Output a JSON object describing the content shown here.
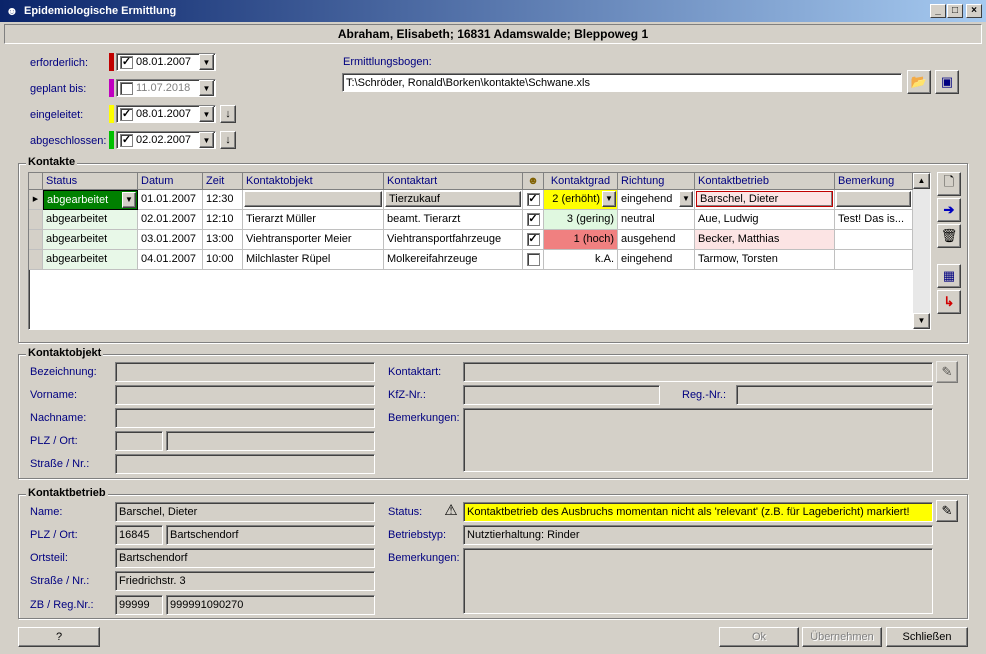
{
  "window": {
    "title": "Epidemiologische Ermittlung",
    "icon": "person-icon"
  },
  "header": {
    "text": "Abraham, Elisabeth; 16831 Adamswalde; Bleppoweg 1"
  },
  "dates": [
    {
      "label": "erforderlich:",
      "value": "08.01.2007",
      "checked": true,
      "color": "#c00000"
    },
    {
      "label": "geplant bis:",
      "value": "11.07.2018",
      "checked": false,
      "color": "#c000c0"
    },
    {
      "label": "eingeleitet:",
      "value": "08.01.2007",
      "checked": true,
      "color": "#ffff00"
    },
    {
      "label": "abgeschlossen:",
      "value": "02.02.2007",
      "checked": true,
      "color": "#00c000"
    }
  ],
  "ermittlungsbogen": {
    "label": "Ermittlungsbogen:",
    "value": "T:\\Schröder, Ronald\\Borken\\kontakte\\Schwane.xls"
  },
  "kontakte": {
    "title": "Kontakte",
    "columns": [
      "Status",
      "Datum",
      "Zeit",
      "Kontaktobjekt",
      "Kontaktart",
      "",
      "Kontaktgrad",
      "Richtung",
      "Kontaktbetrieb",
      "Bemerkung"
    ],
    "rows": [
      {
        "status": "abgearbeitet",
        "datum": "01.01.2007",
        "zeit": "12:30",
        "objekt": "",
        "art": "Tierzukauf",
        "checked": true,
        "grad": "2 (erhöht)",
        "richtung": "eingehend",
        "betrieb": "Barschel, Dieter",
        "bemerkung": ""
      },
      {
        "status": "abgearbeitet",
        "datum": "02.01.2007",
        "zeit": "12:10",
        "objekt": "Tierarzt Müller",
        "art": "beamt. Tierarzt",
        "checked": true,
        "grad": "3 (gering)",
        "richtung": "neutral",
        "betrieb": "Aue, Ludwig",
        "bemerkung": "Test! Das is..."
      },
      {
        "status": "abgearbeitet",
        "datum": "03.01.2007",
        "zeit": "13:00",
        "objekt": "Viehtransporter Meier",
        "art": "Viehtransportfahrzeuge",
        "checked": true,
        "grad": "1 (hoch)",
        "richtung": "ausgehend",
        "betrieb": "Becker, Matthias",
        "bemerkung": ""
      },
      {
        "status": "abgearbeitet",
        "datum": "04.01.2007",
        "zeit": "10:00",
        "objekt": "Milchlaster Rüpel",
        "art": "Molkereifahrzeuge",
        "checked": false,
        "grad": "k.A.",
        "richtung": "eingehend",
        "betrieb": "Tarmow, Torsten",
        "bemerkung": ""
      }
    ]
  },
  "kontaktobjekt": {
    "title": "Kontaktobjekt",
    "labels": {
      "bezeichnung": "Bezeichnung:",
      "vorname": "Vorname:",
      "nachname": "Nachname:",
      "plz": "PLZ / Ort:",
      "strasse": "Straße / Nr.:",
      "kontaktart": "Kontaktart:",
      "kfz": "KfZ-Nr.:",
      "reg": "Reg.-Nr.:",
      "bemerkungen": "Bemerkungen:"
    }
  },
  "kontaktbetrieb": {
    "title": "Kontaktbetrieb",
    "labels": {
      "name": "Name:",
      "plz": "PLZ / Ort:",
      "ortsteil": "Ortsteil:",
      "strasse": "Straße / Nr.:",
      "zb": "ZB / Reg.Nr.:",
      "status": "Status:",
      "betriebstyp": "Betriebstyp:",
      "bemerkungen": "Bemerkungen:"
    },
    "name": "Barschel, Dieter",
    "plz": "16845",
    "ort": "Bartschendorf",
    "ortsteil": "Bartschendorf",
    "strasse": "Friedrichstr. 3",
    "zb": "99999",
    "regnr": "999991090270",
    "status": "Kontaktbetrieb des Ausbruchs momentan nicht als 'relevant' (z.B. für Lagebericht) markiert!",
    "betriebstyp": "Nutztierhaltung: Rinder"
  },
  "buttons": {
    "help": "?",
    "ok": "Ok",
    "apply": "Übernehmen",
    "close": "Schließen"
  },
  "colors": {
    "status_green": "#008000",
    "grad_yellow": "#ffff00",
    "grad_green": "#e0f8e0",
    "grad_red": "#f08080",
    "status_bg": "#e8f8e8",
    "betrieb_red": "#fce4e4",
    "warning": "#ffff00"
  }
}
